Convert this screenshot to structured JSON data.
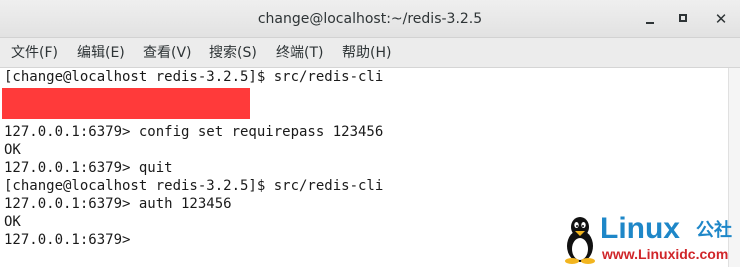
{
  "window": {
    "title": "change@localhost:~/redis-3.2.5"
  },
  "menu": [
    {
      "label": "文件(F)"
    },
    {
      "label": "编辑(E)"
    },
    {
      "label": "查看(V)"
    },
    {
      "label": "搜索(S)"
    },
    {
      "label": "终端(T)"
    },
    {
      "label": "帮助(H)"
    }
  ],
  "terminal": {
    "lines": [
      "[change@localhost redis-3.2.5]$ src/redis-cli",
      "127.0.0.1:6379> config set requirepass 123456",
      "OK",
      "127.0.0.1:6379> quit",
      "[change@localhost redis-3.2.5]$ src/redis-cli",
      "127.0.0.1:6379> auth 123456",
      "OK",
      "127.0.0.1:6379> "
    ],
    "redaction_color": "#ff3a3a"
  },
  "watermark": {
    "brand": "Linux",
    "brand_cn": "公社",
    "url": "www.Linuxidc.com",
    "brand_color": "#1e87c8",
    "url_color": "#d0262a"
  }
}
